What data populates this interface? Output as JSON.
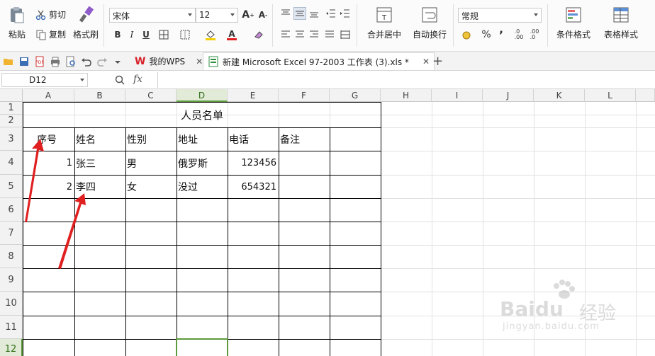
{
  "ribbon": {
    "paste": "粘贴",
    "cut": "剪切",
    "copy": "复制",
    "format_painter": "格式刷",
    "font_name": "宋体",
    "font_size": "12",
    "merge_center": "合并居中",
    "wrap_text": "自动换行",
    "number_format": "常规",
    "percent": "%",
    "thousands": "’",
    "dec_inc": ".0\n.00",
    "dec_dec": ".00\n.0",
    "conditional_format": "条件格式",
    "table_style": "表格样式",
    "bold": "B",
    "italic": "I",
    "underline": "U",
    "font_grow": "A",
    "font_shrink": "A",
    "font_color": "A"
  },
  "tabs": {
    "wps_home": "我的WPS",
    "file_tab": "新建 Microsoft Excel 97-2003 工作表 (3).xls *",
    "add": "+"
  },
  "formula_bar": {
    "name_box": "D12",
    "fx": "fx",
    "formula": ""
  },
  "sheet": {
    "columns": [
      "A",
      "B",
      "C",
      "D",
      "E",
      "F",
      "G",
      "H",
      "I",
      "J",
      "K",
      "L"
    ],
    "rows": [
      "1",
      "2",
      "3",
      "4",
      "5",
      "6",
      "7",
      "8",
      "9",
      "10",
      "11",
      "12"
    ],
    "selected_column": "D",
    "selected_row": "12",
    "title": "人员名单",
    "headers": [
      "序号",
      "姓名",
      "性别",
      "地址",
      "电话",
      "备注"
    ],
    "data": [
      {
        "no": "1",
        "name": "张三",
        "gender": "男",
        "address": "俄罗斯",
        "phone": "123456"
      },
      {
        "no": "2",
        "name": "李四",
        "gender": "女",
        "address": "没过",
        "phone": "654321"
      }
    ]
  },
  "watermark": {
    "brand": "Baidu",
    "brand_cn": "经验",
    "url": "jingyan.baidu.com"
  },
  "colors": {
    "accent_green": "#5d9a3c",
    "annotation_red": "#e02020"
  }
}
